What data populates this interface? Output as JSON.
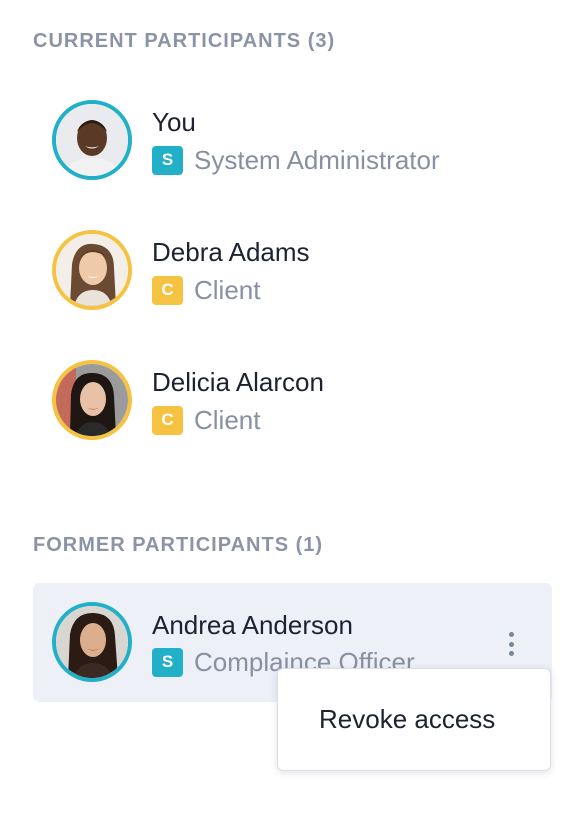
{
  "current": {
    "heading": "CURRENT PARTICIPANTS (3)",
    "participants": [
      {
        "name": "You",
        "badge": "S",
        "role": "System Administrator",
        "avatar": "photo-avatar-man",
        "ring_color": "#22b0c9"
      },
      {
        "name": "Debra Adams",
        "badge": "C",
        "role": "Client",
        "avatar": "photo-avatar-woman",
        "ring_color": "#f5c242"
      },
      {
        "name": "Delicia Alarcon",
        "badge": "C",
        "role": "Client",
        "avatar": "photo-avatar-woman",
        "ring_color": "#f5c242"
      }
    ]
  },
  "former": {
    "heading": "FORMER PARTICIPANTS (1)",
    "participants": [
      {
        "name": "Andrea Anderson",
        "badge": "S",
        "role": "Complaince Officer",
        "avatar": "photo-avatar-woman",
        "ring_color": "#22b0c9"
      }
    ]
  },
  "menu": {
    "icon": "more-vertical-icon",
    "items": [
      {
        "label": "Revoke access"
      }
    ]
  },
  "colors": {
    "staff_badge": "#22b0c9",
    "client_badge": "#f5c242",
    "heading_text": "#8a94a6",
    "card_background": "#edf0f7"
  }
}
